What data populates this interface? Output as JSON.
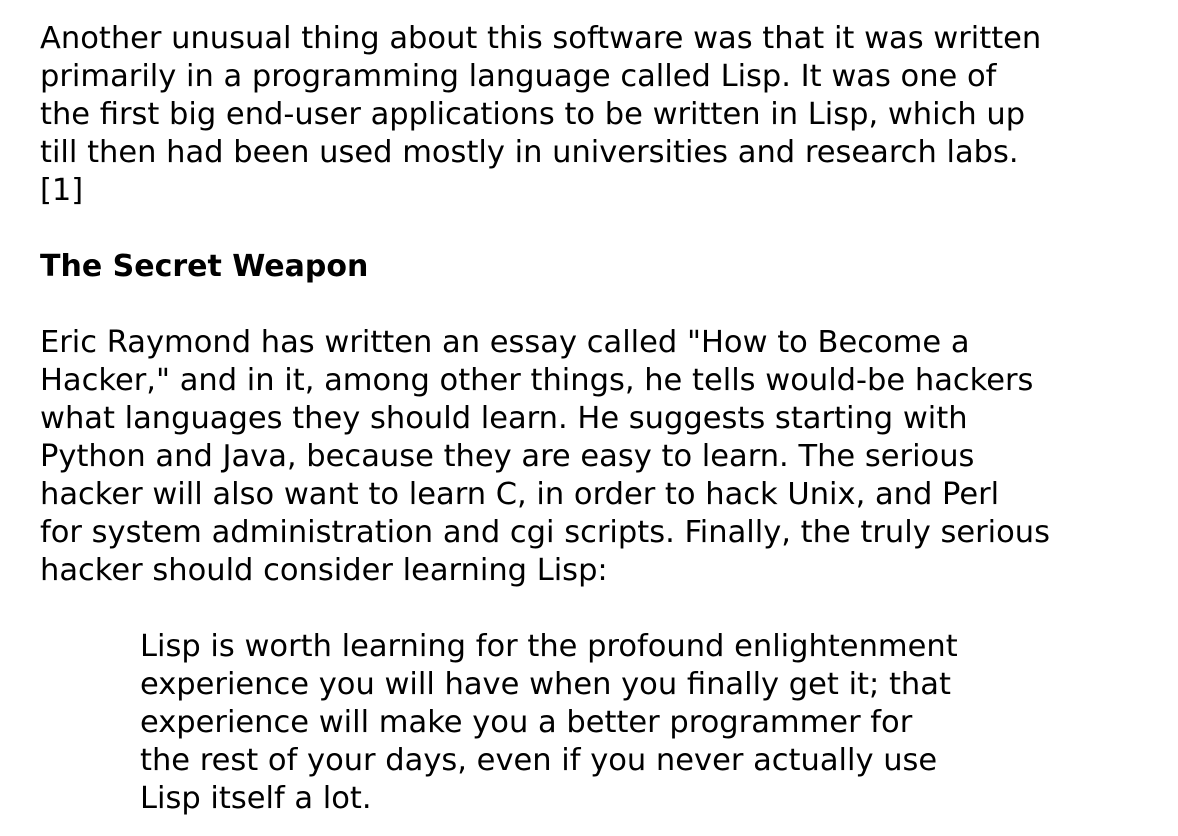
{
  "paragraph_1": {
    "lines": [
      "Another unusual thing about this software was that it was written",
      "primarily in a programming language called Lisp. It was one of",
      "the first big end-user applications to be written in Lisp, which up",
      "till then had been used mostly in universities and research labs.",
      "[1]"
    ]
  },
  "section_heading": "The Secret Weapon",
  "paragraph_2": {
    "lines": [
      "Eric Raymond has written an essay called \"How to Become a",
      "Hacker,\" and in it, among other things, he tells would-be hackers",
      "what languages they should learn. He suggests starting with",
      "Python and Java, because they are easy to learn. The serious",
      "hacker will also want to learn C, in order to hack Unix, and Perl",
      "for system administration and cgi scripts. Finally, the truly serious",
      "hacker should consider learning Lisp:"
    ]
  },
  "blockquote": {
    "lines": [
      "Lisp is worth learning for the profound enlightenment",
      "experience you will have when you finally get it; that",
      "experience will make you a better programmer for",
      "the rest of your days, even if you never actually use",
      "Lisp itself a lot."
    ]
  }
}
